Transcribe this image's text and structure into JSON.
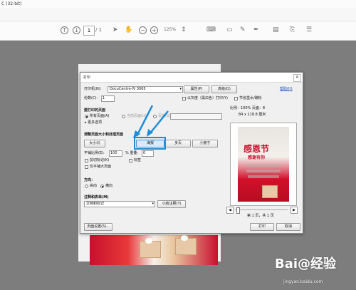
{
  "window_title": "C (32-bit)",
  "toolbar": {
    "page_current": "1",
    "page_total": "/ 1",
    "zoom": "125%",
    "icons": [
      "up-icon",
      "down-icon",
      "select-arrow-icon",
      "hand-icon",
      "zoom-out-icon",
      "zoom-in-icon",
      "fit-icon",
      "comment-icon",
      "pen-icon",
      "sign-icon",
      "doc-icon",
      "share-icon",
      "more-icon"
    ]
  },
  "dialog": {
    "title": "打印",
    "help": "帮助(H)",
    "printer_label": "打印机(N):",
    "printer_value": "DocuCentre-IV 3065",
    "properties_btn": "属性(P)",
    "advanced_btn": "高级(D)",
    "copies_label": "份数(C):",
    "copies_value": "1",
    "grayscale": "以灰度（黑白色）打印(Y)",
    "save_ink": "节省墨水/碳粉",
    "pages_heading": "要打印的页面",
    "all_pages": "所有页面(A)",
    "current_page": "当前页面(U)",
    "pages_opt": "页面(G)",
    "more_options": "▸ 更多选项",
    "size_heading": "调整页面大小和处理页面",
    "tab_size": "大小(I)",
    "tab_poster": "海报",
    "tab_multiple": "多页",
    "tab_booklet": "小册子",
    "tile_scale_label": "平铺比例(E):",
    "tile_scale_value": "100",
    "overlap_label": "% 重叠:",
    "overlap_value": "0",
    "cut_marks": "剪切标记(K)",
    "labels": "标签",
    "tile_large": "仅平铺大页面",
    "orientation_heading": "方向：",
    "portrait": "纵向",
    "landscape": "横向",
    "comments_heading": "注释和表单(M)",
    "comments_value": "文档和标记",
    "summarize_btn": "小结注释(T)",
    "zoom_info": "比例：100% 页面：8",
    "paper_size": "84 x 118.8 厘米",
    "page_counter": "第 1 页，共 1 页",
    "page_setup_btn": "页面设置(S)...",
    "print_btn": "打印",
    "cancel_btn": "取消"
  },
  "poster": {
    "headline": "感恩节",
    "subline": "感谢有你"
  },
  "watermark": {
    "brand": "Bai@经验",
    "url": "jingyan.baidu.com"
  }
}
